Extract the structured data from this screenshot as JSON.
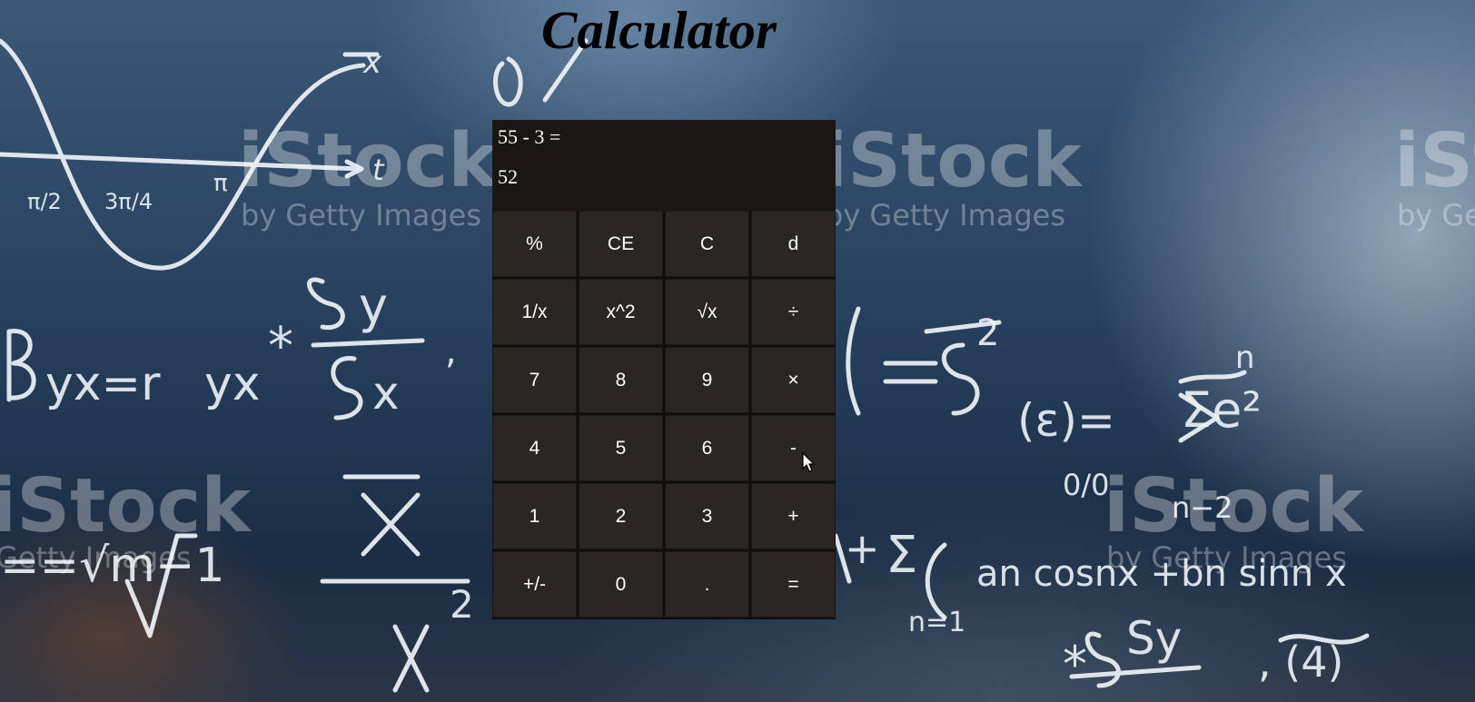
{
  "page": {
    "title": "Calculator"
  },
  "background": {
    "watermark_brand": "iStock",
    "watermark_sub": "by Getty Images"
  },
  "display": {
    "expression": "55 - 3 =",
    "result": "52"
  },
  "keys": [
    {
      "label": "%",
      "name": "percent-button"
    },
    {
      "label": "CE",
      "name": "clear-entry-button"
    },
    {
      "label": "C",
      "name": "clear-button"
    },
    {
      "label": "d",
      "name": "delete-button"
    },
    {
      "label": "1/x",
      "name": "reciprocal-button"
    },
    {
      "label": "x^2",
      "name": "square-button"
    },
    {
      "label": "√x",
      "name": "square-root-button"
    },
    {
      "label": "÷",
      "name": "divide-button"
    },
    {
      "label": "7",
      "name": "digit-7-button"
    },
    {
      "label": "8",
      "name": "digit-8-button"
    },
    {
      "label": "9",
      "name": "digit-9-button"
    },
    {
      "label": "×",
      "name": "multiply-button"
    },
    {
      "label": "4",
      "name": "digit-4-button"
    },
    {
      "label": "5",
      "name": "digit-5-button"
    },
    {
      "label": "6",
      "name": "digit-6-button"
    },
    {
      "label": "-",
      "name": "subtract-button"
    },
    {
      "label": "1",
      "name": "digit-1-button"
    },
    {
      "label": "2",
      "name": "digit-2-button"
    },
    {
      "label": "3",
      "name": "digit-3-button"
    },
    {
      "label": "+",
      "name": "add-button"
    },
    {
      "label": "+/-",
      "name": "negate-button"
    },
    {
      "label": "0",
      "name": "digit-0-button"
    },
    {
      "label": ".",
      "name": "decimal-button"
    },
    {
      "label": "=",
      "name": "equals-button"
    }
  ],
  "colors": {
    "display_bg": "#1a1615",
    "key_bg": "#292624",
    "key_text": "#ffffff",
    "title_text": "#000000"
  }
}
